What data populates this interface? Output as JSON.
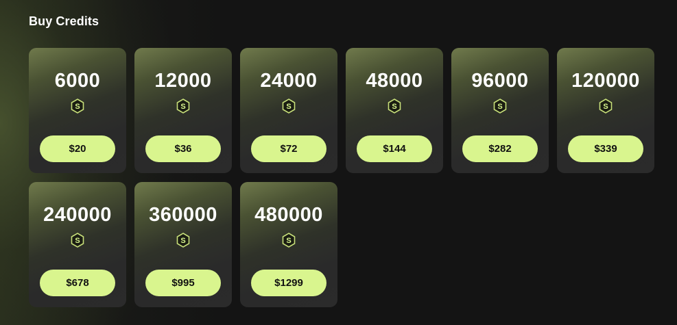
{
  "page": {
    "title": "Buy Credits"
  },
  "colors": {
    "accent": "#d9f58e",
    "background": "#141414",
    "card": "#2b2b2b"
  },
  "packages": [
    {
      "credits": "6000",
      "price": "$20",
      "icon": "credit-coin-icon"
    },
    {
      "credits": "12000",
      "price": "$36",
      "icon": "credit-coin-icon"
    },
    {
      "credits": "24000",
      "price": "$72",
      "icon": "credit-coin-icon"
    },
    {
      "credits": "48000",
      "price": "$144",
      "icon": "credit-coin-icon"
    },
    {
      "credits": "96000",
      "price": "$282",
      "icon": "credit-coin-icon"
    },
    {
      "credits": "120000",
      "price": "$339",
      "icon": "credit-coin-icon"
    },
    {
      "credits": "240000",
      "price": "$678",
      "icon": "credit-coin-icon"
    },
    {
      "credits": "360000",
      "price": "$995",
      "icon": "credit-coin-icon"
    },
    {
      "credits": "480000",
      "price": "$1299",
      "icon": "credit-coin-icon"
    }
  ]
}
